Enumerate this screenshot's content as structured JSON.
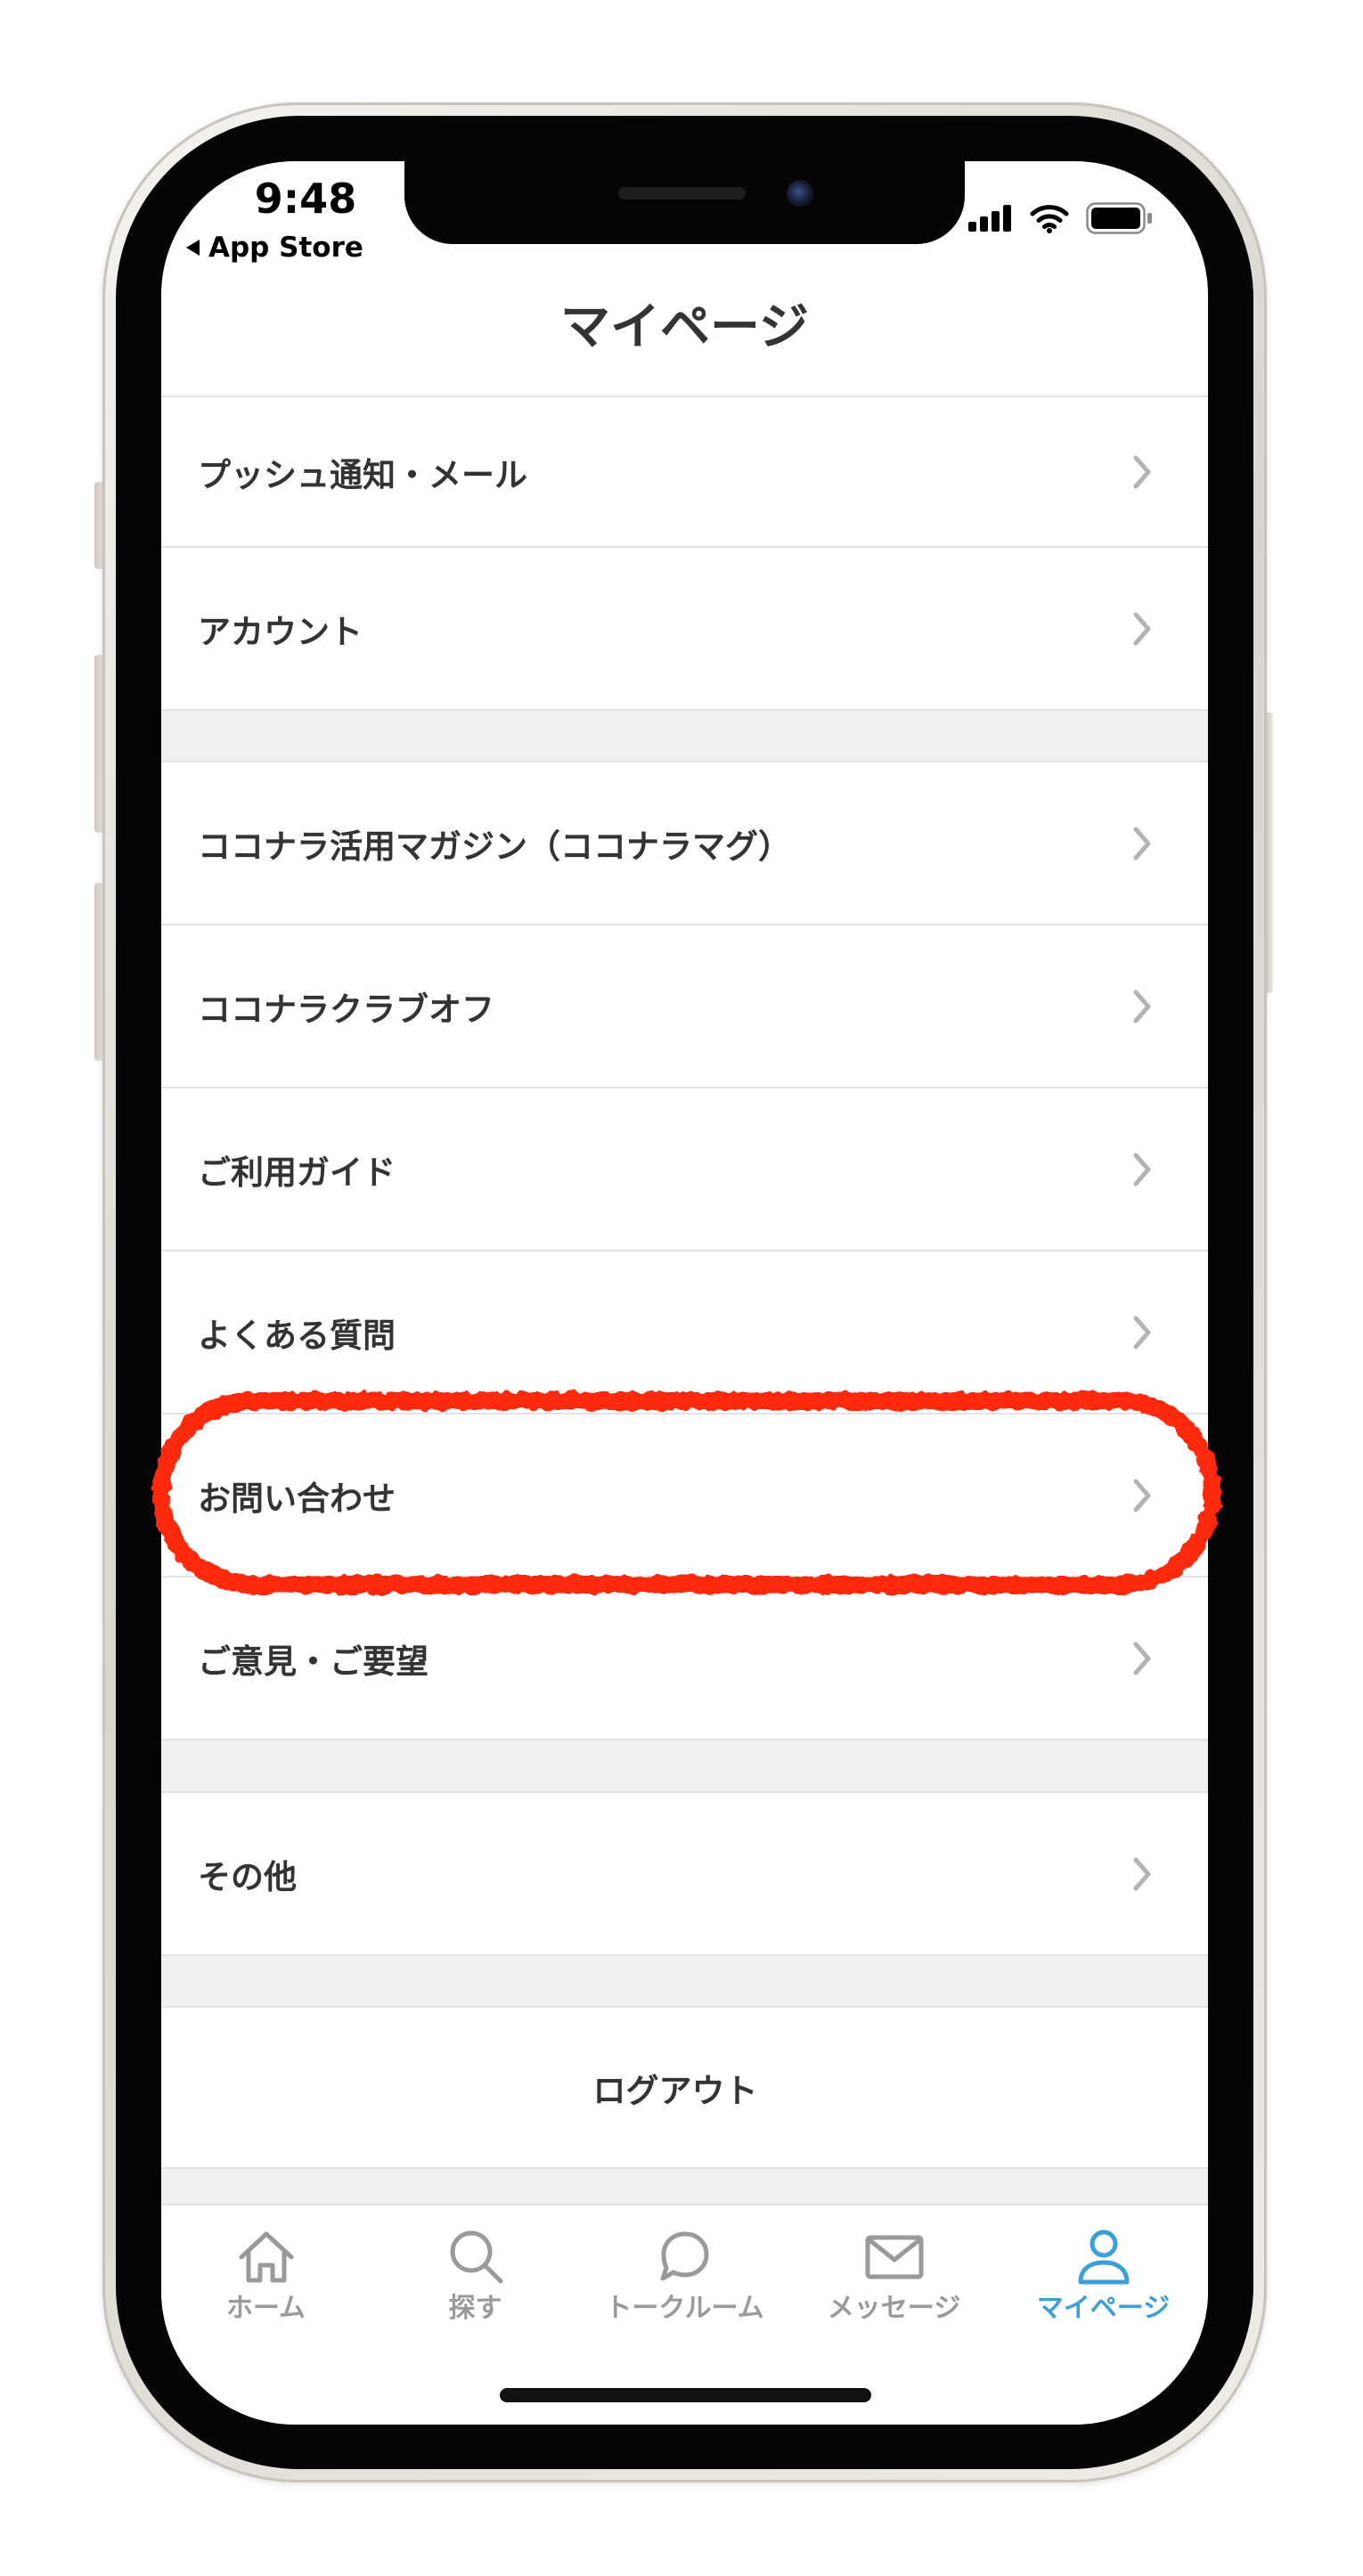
{
  "status_bar": {
    "time": "9:48",
    "back_app": "App Store"
  },
  "header": {
    "title": "マイページ"
  },
  "menu": {
    "section_1": [
      {
        "label": "プッシュ通知・メール"
      },
      {
        "label": "アカウント"
      }
    ],
    "section_2": [
      {
        "label": "ココナラ活用マガジン（ココナラマグ）"
      },
      {
        "label": "ココナラクラブオフ"
      },
      {
        "label": "ご利用ガイド"
      },
      {
        "label": "よくある質問"
      },
      {
        "label": "お問い合わせ",
        "highlighted": true
      },
      {
        "label": "ご意見・ご要望"
      }
    ],
    "section_3": [
      {
        "label": "その他"
      }
    ],
    "logout_label": "ログアウト"
  },
  "tab_bar": {
    "active_index": 4,
    "items": [
      {
        "label": "ホーム",
        "icon": "home-icon"
      },
      {
        "label": "探す",
        "icon": "search-icon"
      },
      {
        "label": "トークルーム",
        "icon": "chat-bubble-icon"
      },
      {
        "label": "メッセージ",
        "icon": "envelope-icon"
      },
      {
        "label": "マイページ",
        "icon": "person-icon"
      }
    ]
  },
  "colors": {
    "accent": "#3d9fd8",
    "text": "#333333",
    "inactive": "#9a9a9a",
    "annotation": "#ff2b0c"
  }
}
